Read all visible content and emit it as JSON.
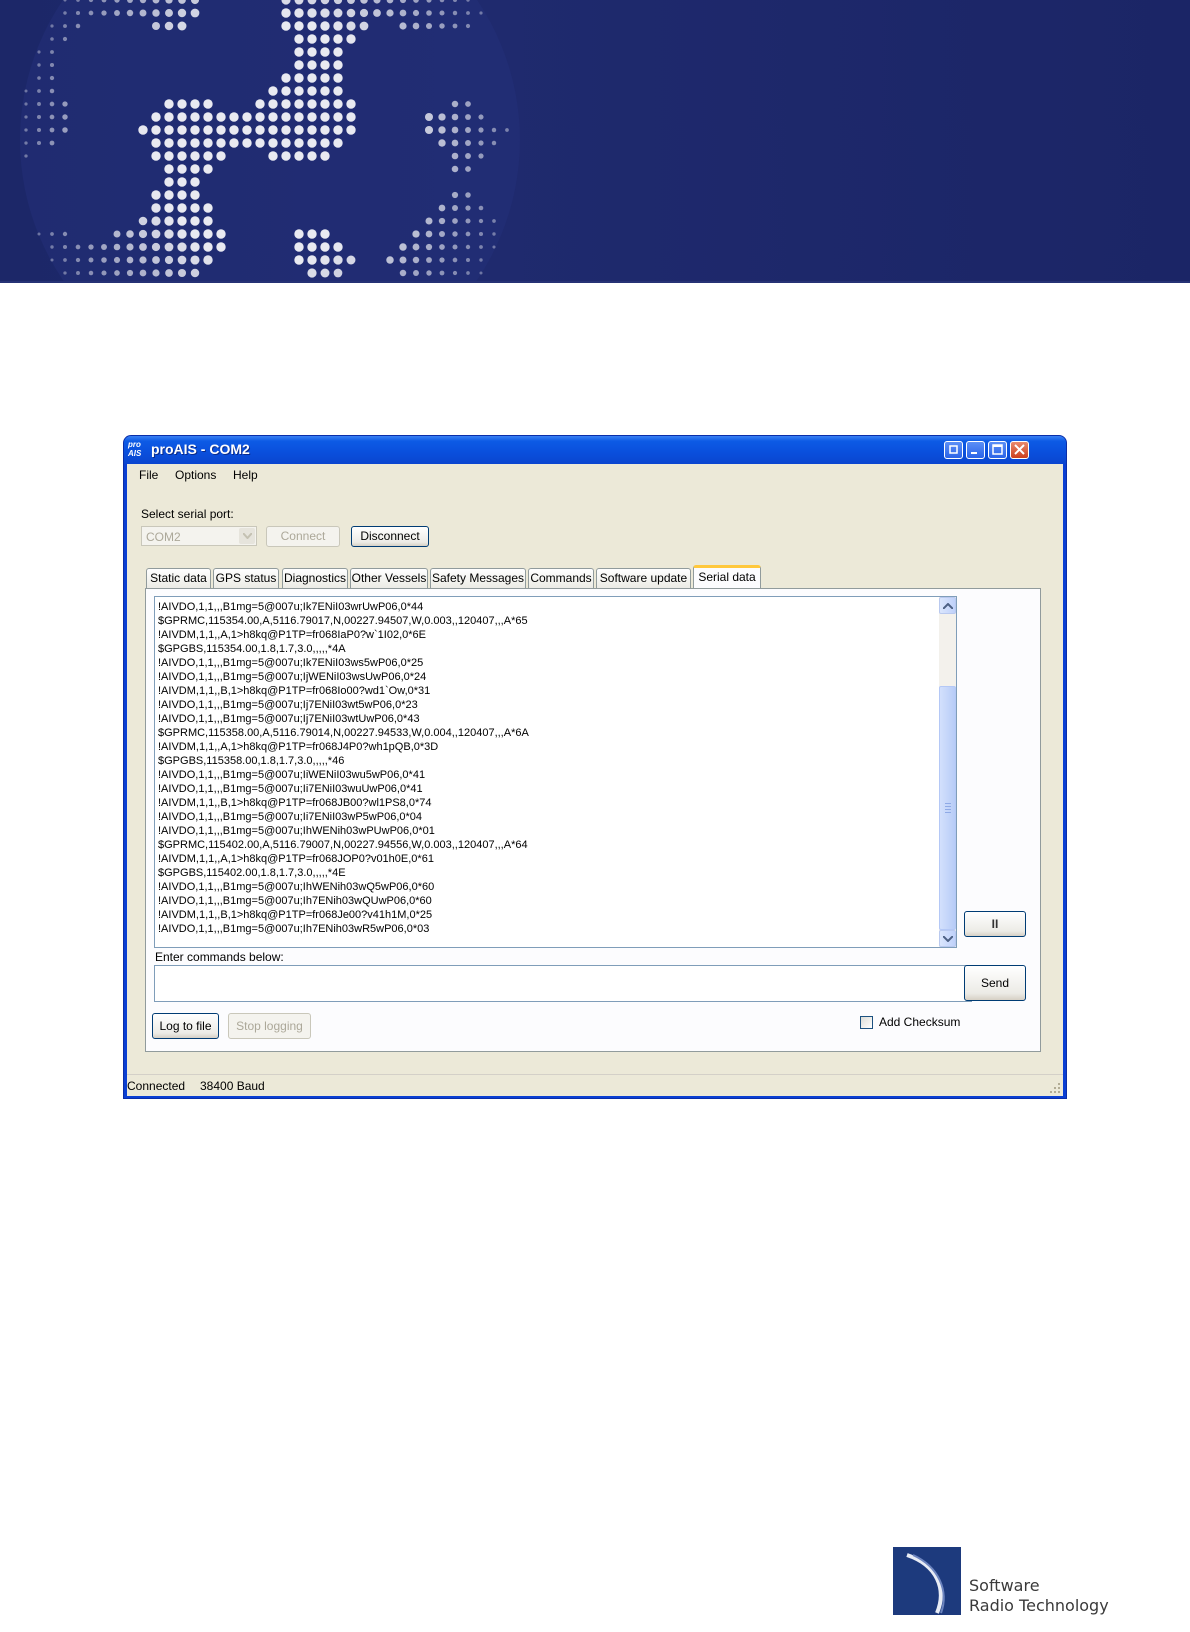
{
  "window": {
    "title": "proAIS - COM2",
    "logo_top": "pro",
    "logo_bottom": "AIS"
  },
  "menu": {
    "file": "File",
    "options": "Options",
    "help": "Help"
  },
  "connection": {
    "serial_port_label": "Select serial port:",
    "port_value": "COM2",
    "connect_label": "Connect",
    "disconnect_label": "Disconnect"
  },
  "tabs": [
    {
      "label": "Static data"
    },
    {
      "label": "GPS status"
    },
    {
      "label": "Diagnostics"
    },
    {
      "label": "Other Vessels"
    },
    {
      "label": "Safety Messages"
    },
    {
      "label": "Commands"
    },
    {
      "label": "Software update"
    },
    {
      "label": "Serial data"
    }
  ],
  "active_tab": "Serial data",
  "serial": {
    "lines": [
      "!AIVDO,1,1,,,B1mg=5@007u;Ik7ENiI03wrUwP06,0*44",
      "$GPRMC,115354.00,A,5116.79017,N,00227.94507,W,0.003,,120407,,,A*65",
      "!AIVDM,1,1,,A,1>h8kq@P1TP=fr068IaP0?w`1I02,0*6E",
      "$GPGBS,115354.00,1.8,1.7,3.0,,,,,*4A",
      "!AIVDO,1,1,,,B1mg=5@007u;Ik7ENiI03ws5wP06,0*25",
      "!AIVDO,1,1,,,B1mg=5@007u;IjWENiI03wsUwP06,0*24",
      "!AIVDM,1,1,,B,1>h8kq@P1TP=fr068Io00?wd1`Ow,0*31",
      "!AIVDO,1,1,,,B1mg=5@007u;Ij7ENiI03wt5wP06,0*23",
      "!AIVDO,1,1,,,B1mg=5@007u;Ij7ENiI03wtUwP06,0*43",
      "$GPRMC,115358.00,A,5116.79014,N,00227.94533,W,0.004,,120407,,,A*6A",
      "!AIVDM,1,1,,A,1>h8kq@P1TP=fr068J4P0?wh1pQB,0*3D",
      "$GPGBS,115358.00,1.8,1.7,3.0,,,,,*46",
      "!AIVDO,1,1,,,B1mg=5@007u;IiWENiI03wu5wP06,0*41",
      "!AIVDO,1,1,,,B1mg=5@007u;Ii7ENiI03wuUwP06,0*41",
      "!AIVDM,1,1,,B,1>h8kq@P1TP=fr068JB00?wl1PS8,0*74",
      "!AIVDO,1,1,,,B1mg=5@007u;Ii7ENiI03wP5wP06,0*04",
      "!AIVDO,1,1,,,B1mg=5@007u;IhWENih03wPUwP06,0*01",
      "$GPRMC,115402.00,A,5116.79007,N,00227.94556,W,0.003,,120407,,,A*64",
      "!AIVDM,1,1,,A,1>h8kq@P1TP=fr068JOP0?v01h0E,0*61",
      "$GPGBS,115402.00,1.8,1.7,3.0,,,,,*4E",
      "!AIVDO,1,1,,,B1mg=5@007u;IhWENih03wQ5wP06,0*60",
      "!AIVDO,1,1,,,B1mg=5@007u;Ih7ENih03wQUwP06,0*60",
      "!AIVDM,1,1,,B,1>h8kq@P1TP=fr068Je00?v41h1M,0*25",
      "!AIVDO,1,1,,,B1mg=5@007u;Ih7ENih03wR5wP06,0*03"
    ],
    "pause_label": "II",
    "commands_label": "Enter commands below:",
    "command_value": "",
    "send_label": "Send",
    "log_label": "Log to file",
    "stop_log_label": "Stop logging",
    "checksum_label": "Add Checksum",
    "checksum_checked": false
  },
  "status": {
    "connection": "Connected",
    "baud": "38400 Baud"
  },
  "footer": {
    "line1": "Software",
    "line2": "Radio Technology"
  },
  "colors": {
    "banner": "#1f2a6e",
    "titlebar": "#0a4fdc",
    "window_bg": "#ece9d8",
    "active_tab_accent": "#ffc83c"
  }
}
